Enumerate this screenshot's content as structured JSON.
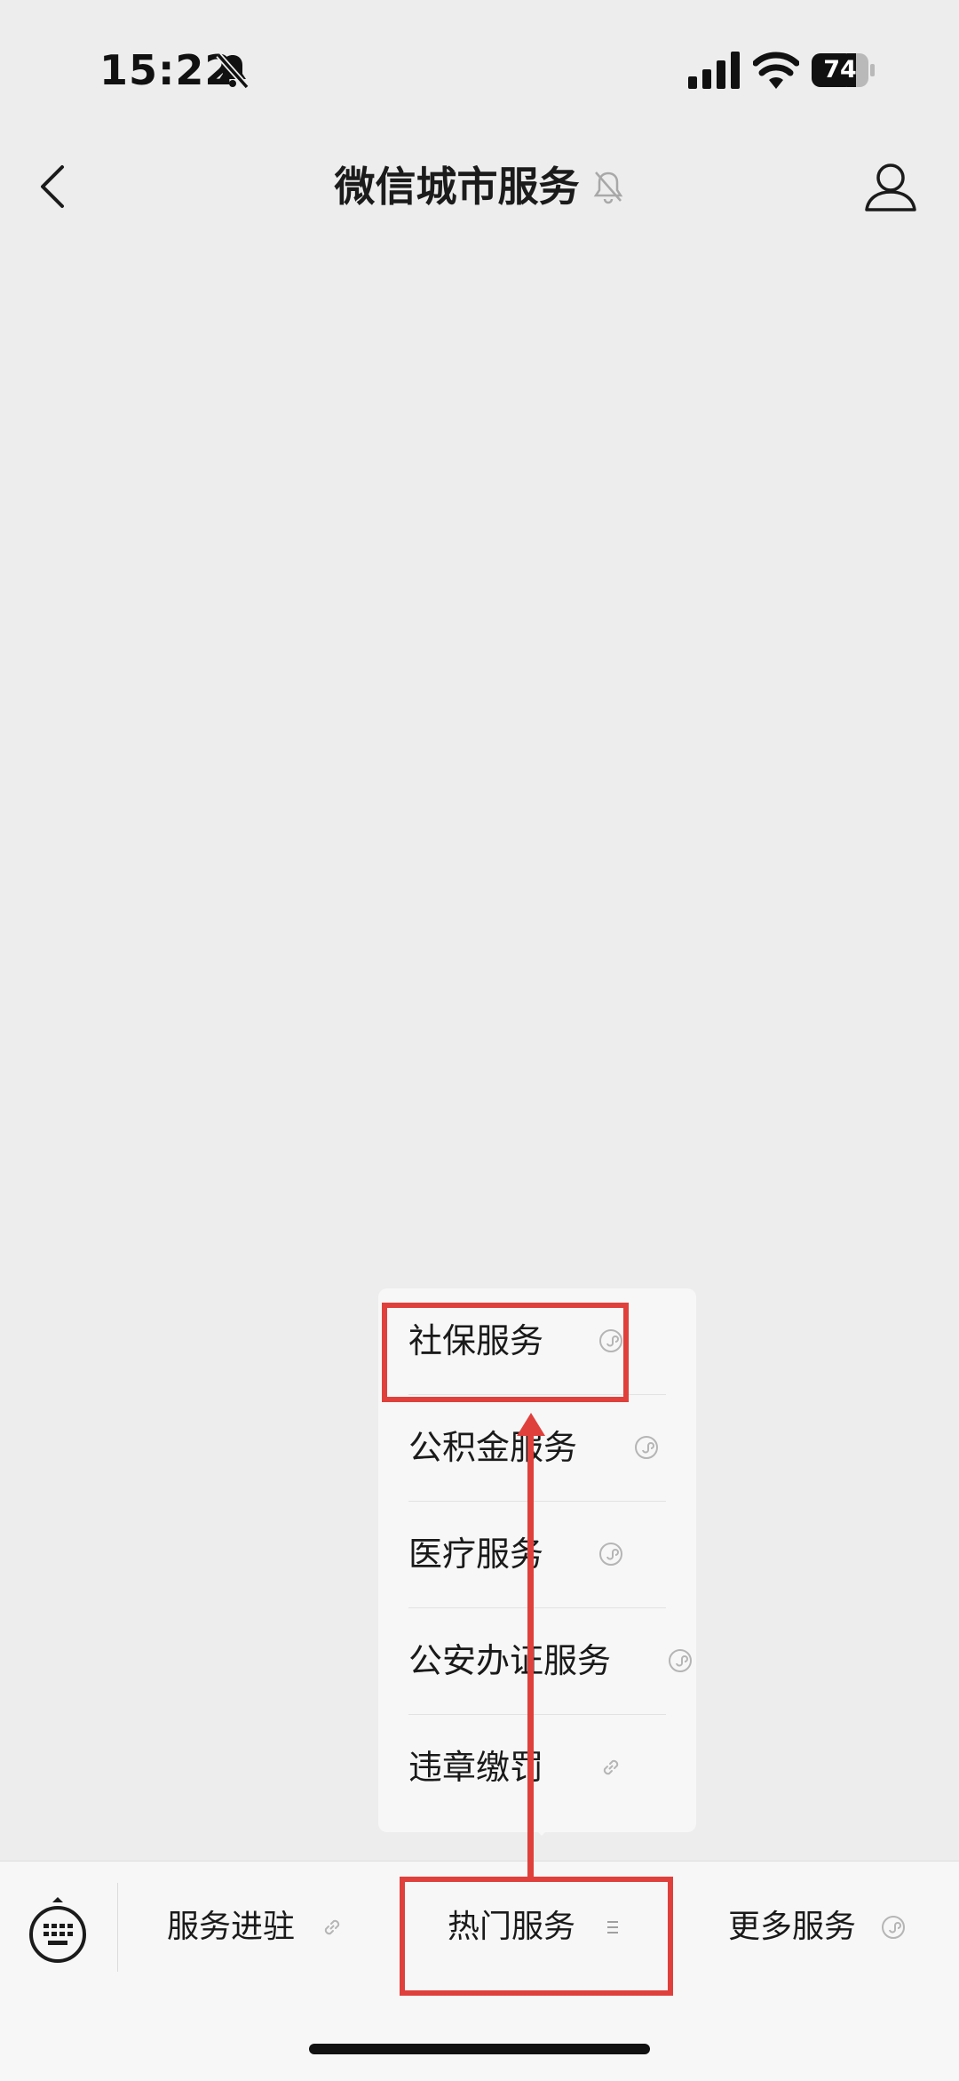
{
  "status_bar": {
    "time": "15:22",
    "battery": "74"
  },
  "nav": {
    "title": "微信城市服务"
  },
  "popup_menu": {
    "items": [
      {
        "label": "社保服务"
      },
      {
        "label": "公积金服务"
      },
      {
        "label": "医疗服务"
      },
      {
        "label": "公安办证服务"
      },
      {
        "label": "违章缴罚"
      }
    ]
  },
  "tab_bar": {
    "tabs": [
      {
        "label": "服务进驻",
        "icon": "link-icon"
      },
      {
        "label": "热门服务",
        "icon": "menu-lines-icon"
      },
      {
        "label": "更多服务",
        "icon": "mini-program-icon"
      }
    ]
  },
  "colors": {
    "background": "#ededed",
    "panel": "#f7f7f7",
    "annotation_red": "#e0403c",
    "text": "#1a1a1a"
  }
}
